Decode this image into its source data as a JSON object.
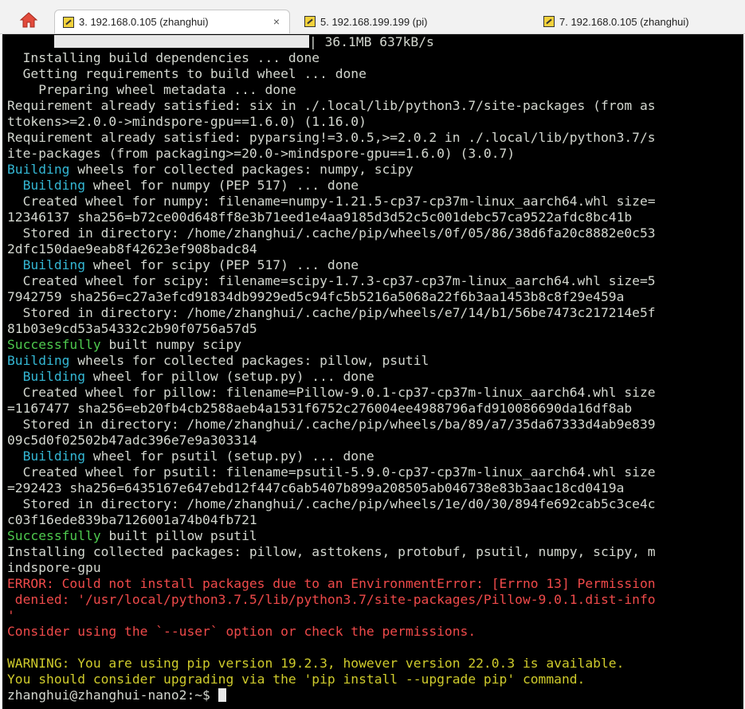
{
  "tabs": [
    {
      "label": "3. 192.168.0.105 (zhanghui)",
      "close": "×"
    },
    {
      "label": "5. 192.168.199.199 (pi)"
    },
    {
      "label": "7. 192.168.0.105 (zhanghui)"
    }
  ],
  "progress": {
    "percent": 100,
    "text": "| 36.1MB 637kB/s"
  },
  "lines": [
    {
      "t": "  Installing build dependencies ... done"
    },
    {
      "t": "  Getting requirements to build wheel ... done"
    },
    {
      "t": "    Preparing wheel metadata ... done"
    },
    {
      "t": "Requirement already satisfied: six in ./.local/lib/python3.7/site-packages (from as"
    },
    {
      "t": "ttokens>=2.0.0->mindspore-gpu==1.6.0) (1.16.0)"
    },
    {
      "t": "Requirement already satisfied: pyparsing!=3.0.5,>=2.0.2 in ./.local/lib/python3.7/s"
    },
    {
      "t": "ite-packages (from packaging>=20.0->mindspore-gpu==1.6.0) (3.0.7)"
    },
    {
      "h": "Building",
      "hc": "cyan",
      "t": " wheels for collected packages: numpy, scipy"
    },
    {
      "p": "  ",
      "h": "Building",
      "hc": "cyan",
      "t": " wheel for numpy (PEP 517) ... done"
    },
    {
      "t": "  Created wheel for numpy: filename=numpy-1.21.5-cp37-cp37m-linux_aarch64.whl size="
    },
    {
      "t": "12346137 sha256=b72ce00d648ff8e3b71eed1e4aa9185d3d52c5c001debc57ca9522afdc8bc41b"
    },
    {
      "t": "  Stored in directory: /home/zhanghui/.cache/pip/wheels/0f/05/86/38d6fa20c8882e0c53"
    },
    {
      "t": "2dfc150dae9eab8f42623ef908badc84"
    },
    {
      "p": "  ",
      "h": "Building",
      "hc": "cyan",
      "t": " wheel for scipy (PEP 517) ... done"
    },
    {
      "t": "  Created wheel for scipy: filename=scipy-1.7.3-cp37-cp37m-linux_aarch64.whl size=5"
    },
    {
      "t": "7942759 sha256=c27a3efcd91834db9929ed5c94fc5b5216a5068a22f6b3aa1453b8c8f29e459a"
    },
    {
      "t": "  Stored in directory: /home/zhanghui/.cache/pip/wheels/e7/14/b1/56be7473c217214e5f"
    },
    {
      "t": "81b03e9cd53a54332c2b90f0756a57d5"
    },
    {
      "h": "Successfully",
      "hc": "green",
      "t": " built numpy scipy"
    },
    {
      "h": "Building",
      "hc": "cyan",
      "t": " wheels for collected packages: pillow, psutil"
    },
    {
      "p": "  ",
      "h": "Building",
      "hc": "cyan",
      "t": " wheel for pillow (setup.py) ... done"
    },
    {
      "t": "  Created wheel for pillow: filename=Pillow-9.0.1-cp37-cp37m-linux_aarch64.whl size"
    },
    {
      "t": "=1167477 sha256=eb20fb4cb2588aeb4a1531f6752c276004ee4988796afd910086690da16df8ab"
    },
    {
      "t": "  Stored in directory: /home/zhanghui/.cache/pip/wheels/ba/89/a7/35da67333d4ab9e839"
    },
    {
      "t": "09c5d0f02502b47adc396e7e9a303314"
    },
    {
      "p": "  ",
      "h": "Building",
      "hc": "cyan",
      "t": " wheel for psutil (setup.py) ... done"
    },
    {
      "t": "  Created wheel for psutil: filename=psutil-5.9.0-cp37-cp37m-linux_aarch64.whl size"
    },
    {
      "t": "=292423 sha256=6435167e647ebd12f447c6ab5407b899a208505ab046738e83b3aac18cd0419a"
    },
    {
      "t": "  Stored in directory: /home/zhanghui/.cache/pip/wheels/1e/d0/30/894fe692cab5c3ce4c"
    },
    {
      "t": "c03f16ede839ba7126001a74b04fb721"
    },
    {
      "h": "Successfully",
      "hc": "green",
      "t": " built pillow psutil"
    },
    {
      "t": "Installing collected packages: pillow, asttokens, protobuf, psutil, numpy, scipy, m"
    },
    {
      "t": "indspore-gpu"
    },
    {
      "c": "red",
      "t": "ERROR: Could not install packages due to an EnvironmentError: [Errno 13] Permission"
    },
    {
      "c": "red",
      "t": " denied: '/usr/local/python3.7.5/lib/python3.7/site-packages/Pillow-9.0.1.dist-info"
    },
    {
      "c": "red",
      "t": "'"
    },
    {
      "c": "red",
      "t": "Consider using the `--user` option or check the permissions."
    },
    {
      "t": ""
    },
    {
      "c": "yellow",
      "t": "WARNING: You are using pip version 19.2.3, however version 22.0.3 is available."
    },
    {
      "c": "yellow",
      "t": "You should consider upgrading via the 'pip install --upgrade pip' command."
    }
  ],
  "prompt": "zhanghui@zhanghui-nano2:~$ ",
  "colors": {
    "background": "#000000",
    "foreground": "#d3d7cf",
    "cyan": "#34b7d4",
    "green": "#4ec94e",
    "red": "#ef4a4a",
    "yellow": "#cfcb2c"
  }
}
